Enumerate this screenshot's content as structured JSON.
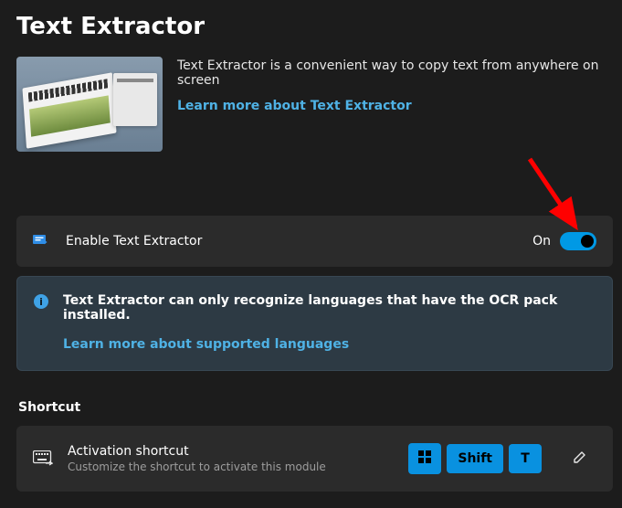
{
  "page_title": "Text Extractor",
  "hero": {
    "description": "Text Extractor is a convenient way to copy text from anywhere on screen",
    "learn_more": "Learn more about Text Extractor"
  },
  "enable": {
    "label": "Enable Text Extractor",
    "state": "On",
    "value": true
  },
  "info": {
    "message": "Text Extractor can only recognize languages that have the OCR pack installed.",
    "link": "Learn more about supported languages"
  },
  "shortcut_section": "Shortcut",
  "shortcut": {
    "title": "Activation shortcut",
    "subtitle": "Customize the shortcut to activate this module",
    "keys": [
      "Win",
      "Shift",
      "T"
    ]
  }
}
